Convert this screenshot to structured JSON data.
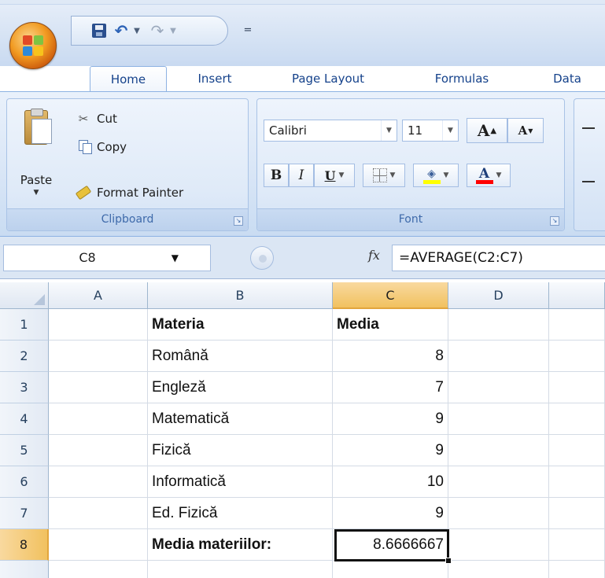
{
  "qat": {
    "save_icon": "save-icon",
    "undo_icon": "undo-icon",
    "redo_icon": "redo-icon",
    "customize_glyph": "="
  },
  "tabs": [
    {
      "label": "Home",
      "active": true
    },
    {
      "label": "Insert"
    },
    {
      "label": "Page Layout"
    },
    {
      "label": "Formulas"
    },
    {
      "label": "Data"
    }
  ],
  "clipboard": {
    "paste_label": "Paste",
    "cut_label": "Cut",
    "copy_label": "Copy",
    "format_painter_label": "Format Painter",
    "group_label": "Clipboard"
  },
  "font": {
    "font_name": "Calibri",
    "font_size": "11",
    "grow_label": "A",
    "shrink_label": "A",
    "bold_label": "B",
    "italic_label": "I",
    "underline_label": "U",
    "font_color_label": "A",
    "group_label": "Font"
  },
  "formula_bar": {
    "name_box": "C8",
    "fx_label": "fx",
    "formula": "=AVERAGE(C2:C7)"
  },
  "sheet": {
    "columns": [
      "A",
      "B",
      "C",
      "D"
    ],
    "rows": [
      "1",
      "2",
      "3",
      "4",
      "5",
      "6",
      "7",
      "8"
    ],
    "selected_cell": "C8",
    "cells": {
      "B1": "Materia",
      "C1": "Media",
      "B2": "Română",
      "C2": "8",
      "B3": "Engleză",
      "C3": "7",
      "B4": "Matematică",
      "C4": "9",
      "B5": "Fizică",
      "C5": "9",
      "B6": "Informatică",
      "C6": "10",
      "B7": "Ed. Fizică",
      "C7": "9",
      "B8": "Media materiilor:",
      "C8": "8.6666667"
    }
  },
  "colors": {
    "ribbon_blue": "#dbe7f7",
    "tab_text": "#15428b",
    "selected_header": "#f1c15f",
    "office_orange": "#f19a21",
    "highlight_yellow": "#ffff00",
    "font_red": "#ff0000"
  }
}
